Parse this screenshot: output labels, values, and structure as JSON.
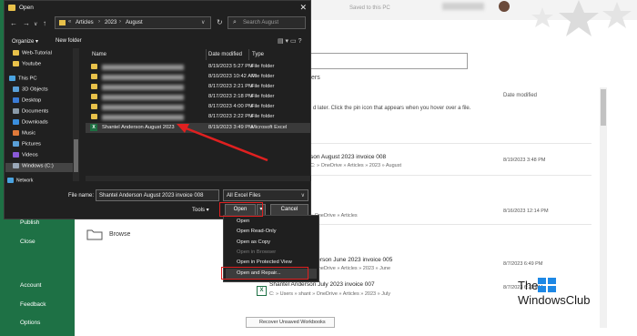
{
  "excel": {
    "sidebar": [
      "Publish",
      "Close",
      "Account",
      "Feedback",
      "Options"
    ],
    "top_status": "Saved to this PC",
    "heading_fragment": "ers",
    "date_column": "Date modified",
    "hint": "d later. Click the pin icon that appears when you hover over a file.",
    "browse": "Browse",
    "recover_button": "Recover Unsaved Workbooks",
    "recent": [
      {
        "title": "son August 2023 invoice 008",
        "path": "C: » OneDrive » Articles » 2023 » August",
        "date": "8/19/2023 3:48 PM"
      },
      {
        "title": "",
        "path": "» OneDrive » Articles",
        "date": "8/16/2023 12:14 PM"
      },
      {
        "title": "nderson June 2023 invoice 005",
        "path": "» OneDrive » Articles » 2023 » June",
        "date": "8/7/2023 6:49 PM"
      },
      {
        "title": "Shantel Anderson July 2023 invoice 007",
        "path": "C: » Users » shant » OneDrive » Articles » 2023 » July",
        "date": "8/7/2023 6:23 PM"
      }
    ]
  },
  "watermark": {
    "line1": "The",
    "line2": "WindowsClub"
  },
  "dialog": {
    "title": "Open",
    "close": "✕",
    "address": [
      "Articles",
      "2023",
      "August"
    ],
    "search_placeholder": "Search August",
    "organize": "Organize ▾",
    "new_folder": "New folder",
    "tree": [
      {
        "label": "Web-Tutorial",
        "color": "#e8c14a"
      },
      {
        "label": "Youtube",
        "color": "#e8c14a"
      },
      {
        "label": "This PC",
        "color": "#4aa3e0"
      },
      {
        "label": "3D Objects",
        "color": "#5aa0d8"
      },
      {
        "label": "Desktop",
        "color": "#3a7bd5"
      },
      {
        "label": "Documents",
        "color": "#8a9aa8"
      },
      {
        "label": "Downloads",
        "color": "#3a8fe0"
      },
      {
        "label": "Music",
        "color": "#e07a3a"
      },
      {
        "label": "Pictures",
        "color": "#5aa0d8"
      },
      {
        "label": "Videos",
        "color": "#8a5ad8"
      },
      {
        "label": "Windows (C:)",
        "color": "#9aa8b8"
      },
      {
        "label": "Network",
        "color": "#4aa3e0"
      }
    ],
    "columns": {
      "name": "Name",
      "date": "Date modified",
      "type": "Type"
    },
    "files": [
      {
        "date": "8/19/2023 5:27 PM",
        "type": "File folder"
      },
      {
        "date": "8/10/2023 10:42 AM",
        "type": "File folder"
      },
      {
        "date": "8/17/2023 2:21 PM",
        "type": "File folder"
      },
      {
        "date": "8/17/2023 2:18 PM",
        "type": "File folder"
      },
      {
        "date": "8/17/2023 4:00 PM",
        "type": "File folder"
      },
      {
        "date": "8/17/2023 2:22 PM",
        "type": "File folder"
      }
    ],
    "selected_file": {
      "name": "Shantel Anderson August 2023",
      "date": "8/19/2023 3:49 PM",
      "type": "Microsoft Excel"
    },
    "file_name_label": "File name:",
    "file_name_value": "Shantel Anderson August 2023 invoice 008",
    "file_type": "All Excel Files",
    "tools": "Tools",
    "open": "Open",
    "cancel": "Cancel"
  },
  "open_menu": [
    "Open",
    "Open Read-Only",
    "Open as Copy",
    "Open in Browser",
    "Open in Protected View",
    "Open and Repair..."
  ],
  "accent": "#e02020"
}
